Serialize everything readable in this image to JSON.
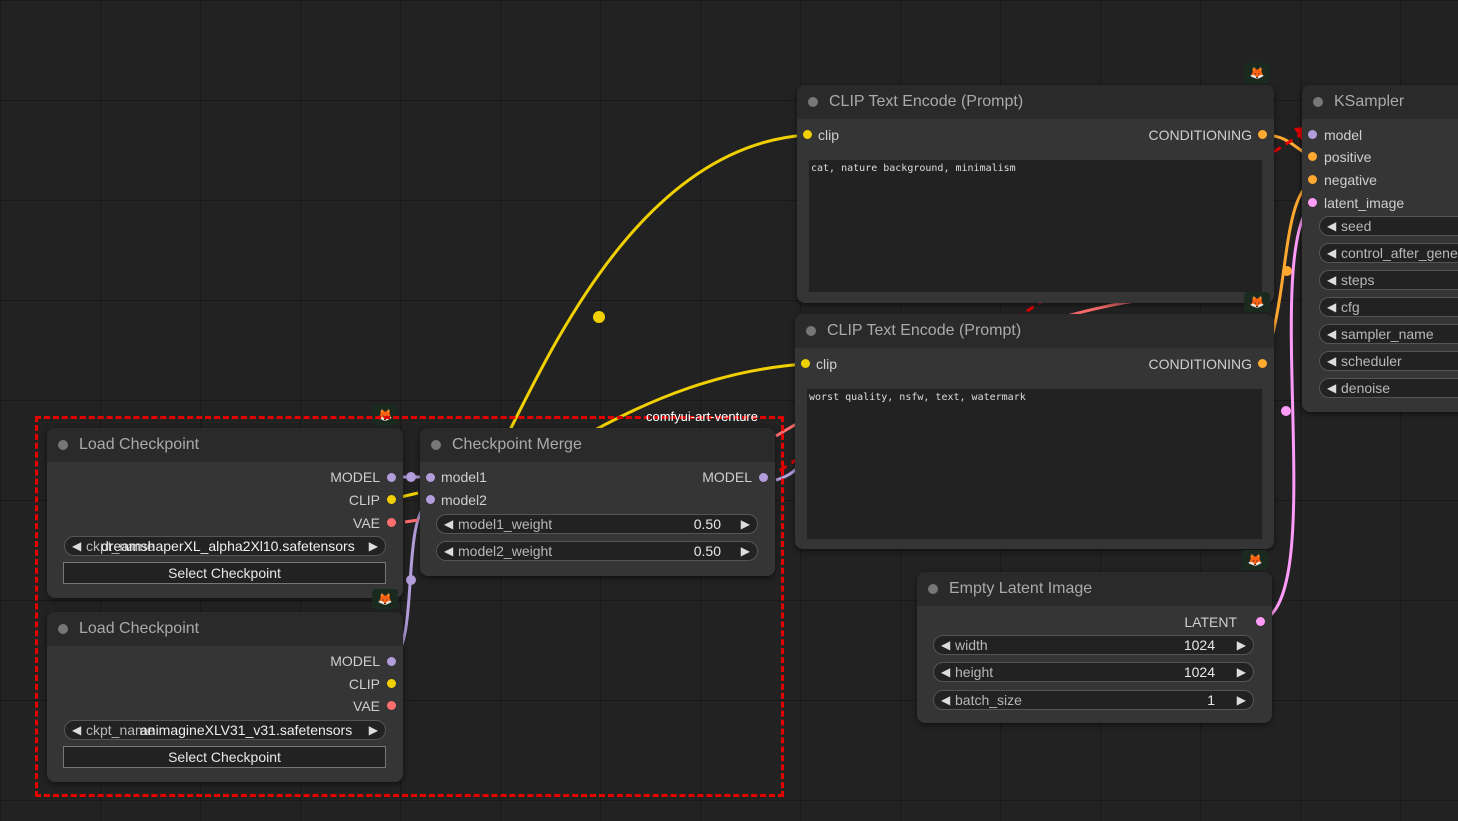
{
  "group": {
    "label": "comfyui-art-venture"
  },
  "colors": {
    "clip": "#f0d000",
    "model": "#b39ddb",
    "vae": "#ff6e6e",
    "conditioning": "#ffa931",
    "latent": "#ff9cf9",
    "annotation": "#e30000"
  },
  "nodes": {
    "load_ckpt_1": {
      "title": "Load Checkpoint",
      "outputs": [
        "MODEL",
        "CLIP",
        "VAE"
      ],
      "ckpt_name_label": "ckpt_name",
      "ckpt_name_value": "dreamshaperXL_alpha2Xl10.safetensors",
      "button": "Select Checkpoint"
    },
    "load_ckpt_2": {
      "title": "Load Checkpoint",
      "outputs": [
        "MODEL",
        "CLIP",
        "VAE"
      ],
      "ckpt_name_label": "ckpt_name",
      "ckpt_name_value": "animagineXLV31_v31.safetensors",
      "button": "Select Checkpoint"
    },
    "ckpt_merge": {
      "title": "Checkpoint Merge",
      "inputs": [
        "model1",
        "model2"
      ],
      "output": "MODEL",
      "model1_weight_label": "model1_weight",
      "model1_weight_value": "0.50",
      "model2_weight_label": "model2_weight",
      "model2_weight_value": "0.50"
    },
    "clip_pos": {
      "title": "CLIP Text Encode (Prompt)",
      "input": "clip",
      "output": "CONDITIONING",
      "text": "cat, nature background, minimalism"
    },
    "clip_neg": {
      "title": "CLIP Text Encode (Prompt)",
      "input": "clip",
      "output": "CONDITIONING",
      "text": "worst quality, nsfw, text, watermark"
    },
    "empty_latent": {
      "title": "Empty Latent Image",
      "output": "LATENT",
      "width_label": "width",
      "width_value": "1024",
      "height_label": "height",
      "height_value": "1024",
      "batch_label": "batch_size",
      "batch_value": "1"
    },
    "ksampler": {
      "title": "KSampler",
      "inputs": [
        "model",
        "positive",
        "negative",
        "latent_image"
      ],
      "widgets": [
        "seed",
        "control_after_gener",
        "steps",
        "cfg",
        "sampler_name",
        "scheduler",
        "denoise"
      ]
    }
  },
  "icons": {
    "badge": "fox-icon"
  }
}
